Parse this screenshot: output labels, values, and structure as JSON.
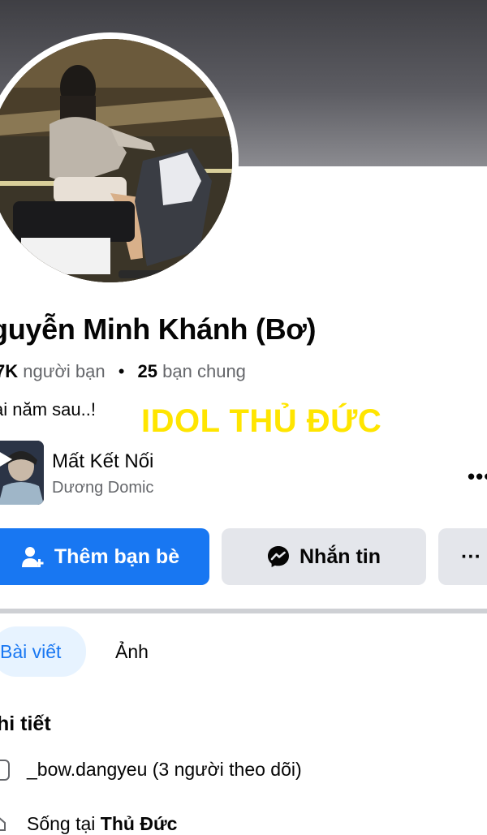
{
  "profile": {
    "name": "guyễn Minh Khánh (Bơ)",
    "stats": {
      "friends_count": "7K",
      "friends_label": "người bạn",
      "separator": "•",
      "mutual_count": "25",
      "mutual_label": "bạn chung"
    },
    "bio": "ai năm sau..!",
    "overlay_caption": "IDOL THỦ ĐỨC"
  },
  "music": {
    "title": "Mất Kết Nối",
    "artist": "Dương Domic"
  },
  "menu": {
    "more_label": "•••"
  },
  "actions": {
    "add_friend_label": "Thêm bạn bè",
    "message_label": "Nhắn tin",
    "more_label": "···"
  },
  "tabs": [
    {
      "label": "Bài viết",
      "active": true
    },
    {
      "label": "Ảnh",
      "active": false
    }
  ],
  "details": {
    "title": "hi tiết",
    "instagram": "_bow.dangyeu (3 người theo dõi)",
    "lives_in_prefix": "Sống tại",
    "lives_in_place": "Thủ Đức"
  },
  "colors": {
    "primary": "#1877f2",
    "secondary_button": "#e4e6eb",
    "overlay_text": "#ffe500",
    "muted_text": "#65676b"
  },
  "icons": {
    "add_friend": "add-friend-icon",
    "messenger": "messenger-icon",
    "instagram": "instagram-icon",
    "home": "home-icon",
    "play": "play-icon"
  }
}
